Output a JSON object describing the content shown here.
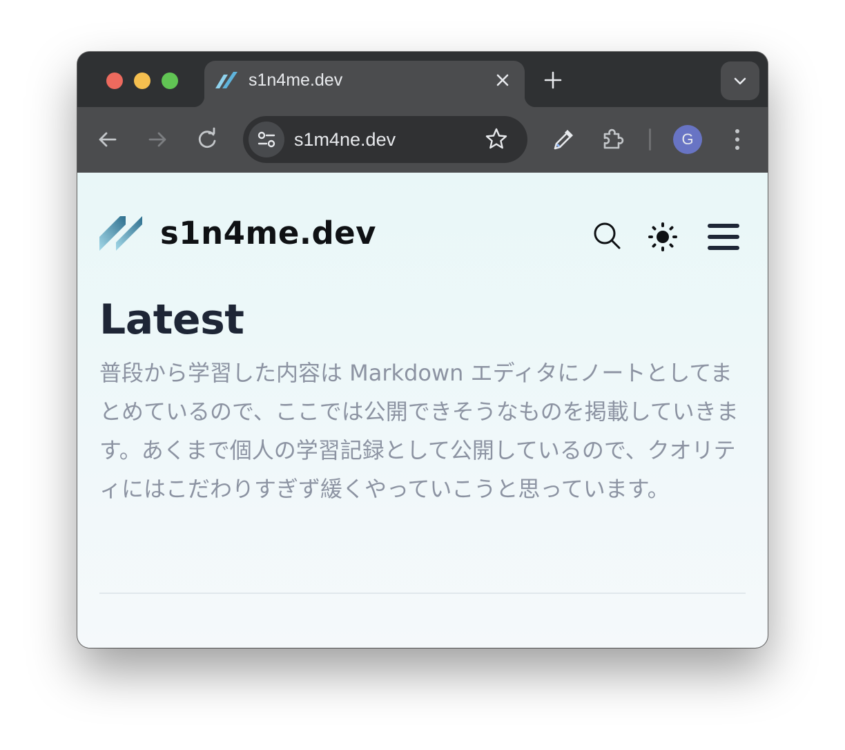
{
  "browser": {
    "tab": {
      "title": "s1n4me.dev",
      "favicon": "s1n4me-logo-icon"
    },
    "address_bar": {
      "url": "s1m4ne.dev"
    },
    "profile_initial": "G",
    "icons": [
      "back-arrow-icon",
      "forward-arrow-icon",
      "reload-icon",
      "site-info-icon",
      "bookmark-star-icon",
      "eyedropper-icon",
      "extensions-puzzle-icon",
      "more-vertical-icon",
      "tab-search-chevron-icon",
      "new-tab-plus-icon",
      "close-tab-icon"
    ]
  },
  "site": {
    "title": "s1n4me.dev",
    "header_icons": [
      "search-icon",
      "theme-toggle-sun-icon",
      "menu-hamburger-icon"
    ]
  },
  "main": {
    "heading": "Latest",
    "intro": "普段から学習した内容は Markdown エディタにノートとしてまとめているので、ここでは公開できそうなものを掲載していきます。あくまで個人の学習記録として公開しているので、クオリティにはこだわりすぎず緩くやっていこうと思っています。"
  },
  "colors": {
    "chrome_dark": "#2f3133",
    "chrome_toolbar": "#4b4c4e",
    "page_bg": "#e9f7f8",
    "heading_text": "#1e2636",
    "body_text": "#8c93a2",
    "avatar_bg": "#6874c4"
  }
}
